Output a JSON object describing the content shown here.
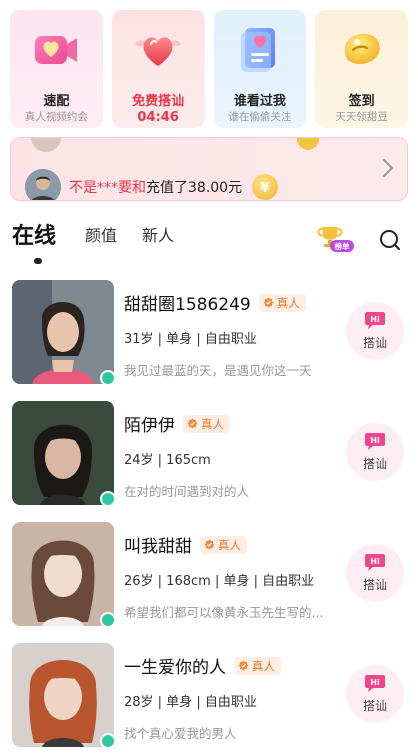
{
  "features": [
    {
      "title": "速配",
      "sub": "真人视频约会",
      "icon": "video-heart-icon"
    },
    {
      "title": "免费搭讪",
      "sub": "04:46",
      "icon": "winged-heart-icon"
    },
    {
      "title": "谁看过我",
      "sub": "谁在偷偷关注",
      "icon": "profile-card-icon"
    },
    {
      "title": "签到",
      "sub": "天天领甜豆",
      "icon": "golden-bean-icon"
    }
  ],
  "banner": {
    "prefix": "不是***要和",
    "suffix": "充值了38.00元"
  },
  "tabs": {
    "online": "在线",
    "looks": "颜值",
    "newcomer": "新人",
    "rank_label": "榜单"
  },
  "verified_label": "真人",
  "hi_label": "搭讪",
  "users": [
    {
      "name": "甜甜圈1586249",
      "info": "31岁 | 单身 | 自由职业",
      "bio": "我见过最蓝的天，是遇见你这一天"
    },
    {
      "name": "陌伊伊",
      "info": "24岁 | 165cm",
      "bio": "在对的时间遇到对的人"
    },
    {
      "name": "叫我甜甜",
      "info": "26岁 | 168cm | 单身 | 自由职业",
      "bio": "希望我们都可以像黄永玉先生写的..."
    },
    {
      "name": "一生爱你的人",
      "info": "28岁 | 单身 | 自由职业",
      "bio": "找个真心爱我的男人"
    }
  ],
  "colors": {
    "accent": "#e8364a",
    "online": "#2ec8a0",
    "verified": "#e87a2a"
  }
}
